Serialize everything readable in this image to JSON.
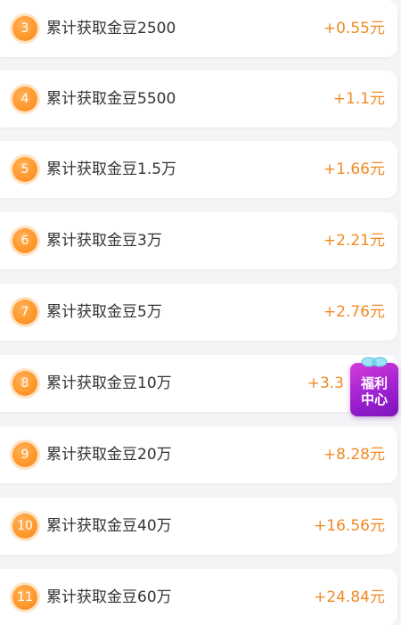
{
  "rewards": [
    {
      "index": "3",
      "label": "累计获取金豆2500",
      "amount": "+0.55元"
    },
    {
      "index": "4",
      "label": "累计获取金豆5500",
      "amount": "+1.1元"
    },
    {
      "index": "5",
      "label": "累计获取金豆1.5万",
      "amount": "+1.66元"
    },
    {
      "index": "6",
      "label": "累计获取金豆3万",
      "amount": "+2.21元"
    },
    {
      "index": "7",
      "label": "累计获取金豆5万",
      "amount": "+2.76元"
    },
    {
      "index": "8",
      "label": "累计获取金豆10万",
      "amount": "+3.3"
    },
    {
      "index": "9",
      "label": "累计获取金豆20万",
      "amount": "+8.28元"
    },
    {
      "index": "10",
      "label": "累计获取金豆40万",
      "amount": "+16.56元"
    },
    {
      "index": "11",
      "label": "累计获取金豆60万",
      "amount": "+24.84元"
    }
  ],
  "welfare_center": {
    "line1": "福利",
    "line2": "中心",
    "icon": "gift-bow-icon"
  },
  "colors": {
    "accent_orange": "#f08a24",
    "badge_orange": "#ff9a2e",
    "welfare_purple": "#9b1fd0"
  }
}
